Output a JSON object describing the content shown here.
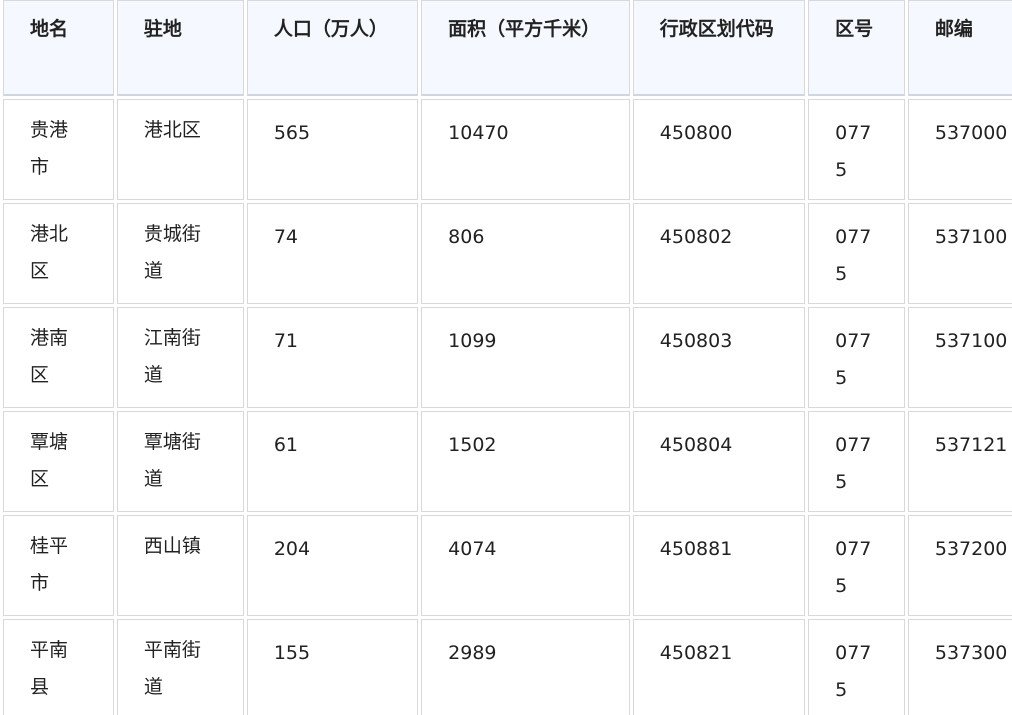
{
  "table": {
    "headers": [
      "地名",
      "驻地",
      "人口（万人）",
      "面积（平方千米）",
      "行政区划代码",
      "区号",
      "邮编"
    ],
    "rows": [
      [
        "贵港市",
        "港北区",
        "565",
        "10470",
        "450800",
        "0775",
        "537000"
      ],
      [
        "港北区",
        "贵城街道",
        "74",
        "806",
        "450802",
        "0775",
        "537100"
      ],
      [
        "港南区",
        "江南街道",
        "71",
        "1099",
        "450803",
        "0775",
        "537100"
      ],
      [
        "覃塘区",
        "覃塘街道",
        "61",
        "1502",
        "450804",
        "0775",
        "537121"
      ],
      [
        "桂平市",
        "西山镇",
        "204",
        "4074",
        "450881",
        "0775",
        "537200"
      ],
      [
        "平南县",
        "平南街道",
        "155",
        "2989",
        "450821",
        "0775",
        "537300"
      ]
    ]
  }
}
